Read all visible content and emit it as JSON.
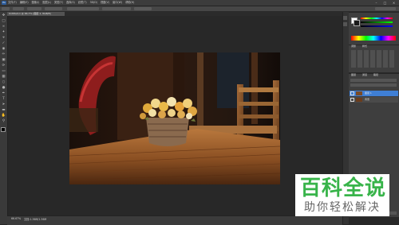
{
  "menubar": {
    "items": [
      "文件(F)",
      "编辑(E)",
      "图像(I)",
      "图层(L)",
      "类型(Y)",
      "选择(S)",
      "滤镜(T)",
      "3D(D)",
      "视图(V)",
      "窗口(W)",
      "帮助(H)"
    ]
  },
  "document": {
    "tab_label": "Untitled-1 @ 66.7% (图层 1, RGB/8)",
    "zoom": "66.67%",
    "doc_info": "文档:1.36M/1.36M"
  },
  "panels": {
    "adjust_tab": "调整",
    "styles_tab": "样式",
    "layers_tab": "图层",
    "channels_tab": "通道",
    "paths_tab": "路径",
    "layer_top": "图层 1",
    "layer_bottom": "背景"
  },
  "watermark": {
    "title": "百科全说",
    "subtitle": "助你轻松解决"
  },
  "colors": {
    "accent": "#3f7fd5",
    "wm_title": "#38b44a",
    "wm_sub": "#666666"
  }
}
